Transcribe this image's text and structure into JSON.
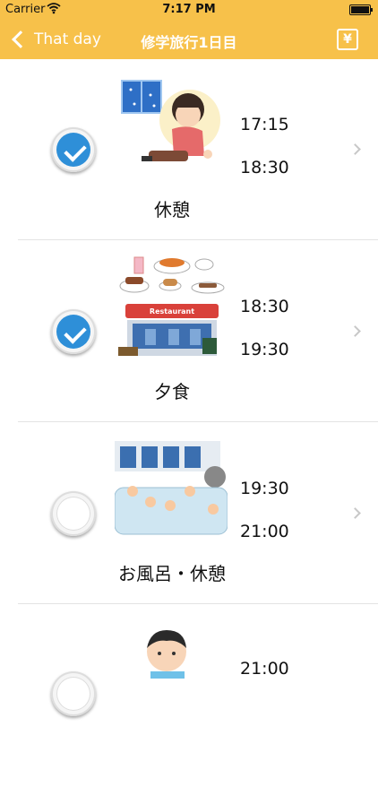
{
  "status_bar": {
    "carrier": "Carrier",
    "time": "7:17 PM"
  },
  "nav": {
    "back_label": "That day",
    "title": "修学旅行1日目",
    "yen_label": "¥"
  },
  "items": [
    {
      "start": "17:15",
      "end": "18:30",
      "label": "休憩",
      "checked": true,
      "icon": "resting-woman-icon"
    },
    {
      "start": "18:30",
      "end": "19:30",
      "label": "夕食",
      "checked": true,
      "icon": "restaurant-icon",
      "sign": "Restaurant"
    },
    {
      "start": "19:30",
      "end": "21:00",
      "label": "お風呂・休憩",
      "checked": false,
      "icon": "public-bath-icon"
    },
    {
      "start": "21:00",
      "checked": false,
      "icon": "boy-icon"
    }
  ],
  "colors": {
    "accent": "#F7C14A",
    "check": "#2E8FD8"
  }
}
